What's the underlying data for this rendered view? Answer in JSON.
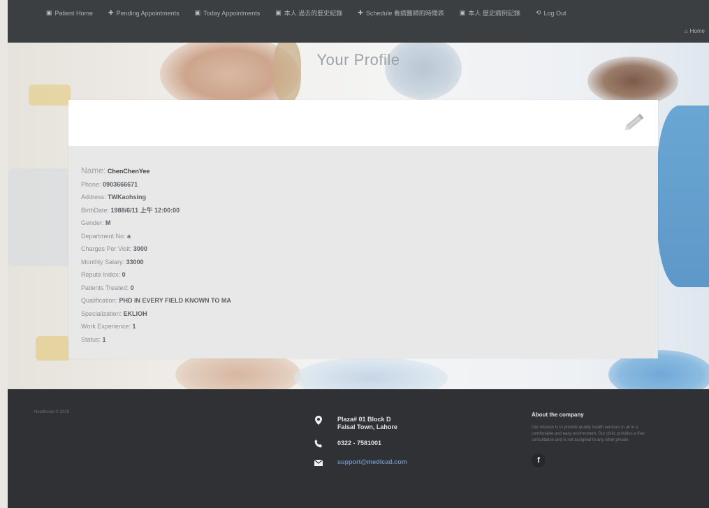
{
  "nav": {
    "items": [
      {
        "icon": "▣",
        "label": "Patient Home"
      },
      {
        "icon": "✚",
        "label": "Pending Appointments"
      },
      {
        "icon": "▣",
        "label": "Today Appointments"
      },
      {
        "icon": "▣",
        "label": "本人 過去的歷史紀錄"
      },
      {
        "icon": "✚",
        "label": "Schedule 看病醫師的時間表"
      },
      {
        "icon": "▣",
        "label": "本人 歷史病例記錄"
      },
      {
        "icon": "⟲",
        "label": "Log Out"
      }
    ],
    "home_label": "Home"
  },
  "page": {
    "title": "Your Profile"
  },
  "profile": {
    "name_label": "Name:",
    "name": "ChenChenYee",
    "fields": [
      {
        "label": "Phone:",
        "value": "0903666671"
      },
      {
        "label": "Address:",
        "value": "TWKaohsing"
      },
      {
        "label": "BirthDate:",
        "value": "1988/6/11 上午 12:00:00"
      },
      {
        "label": "Gender:",
        "value": "M"
      },
      {
        "label": "Department No:",
        "value": "a"
      },
      {
        "label": "Charges Per Visit:",
        "value": "3000"
      },
      {
        "label": "Monthly Salary:",
        "value": "33000"
      },
      {
        "label": "Repute Index:",
        "value": "0"
      },
      {
        "label": "Patients Treated:",
        "value": "0"
      },
      {
        "label": "Qualification:",
        "value": "PHD IN EVERY FIELD KNOWN TO MA"
      },
      {
        "label": "Specialization:",
        "value": "EKLIOH"
      },
      {
        "label": "Work Experience:",
        "value": "1"
      },
      {
        "label": "Status:",
        "value": "1"
      }
    ]
  },
  "footer": {
    "copyright": "Healthcare © 2019",
    "address_line1": "Plaza# 01 Block D",
    "address_line2": "Faisal Town, Lahore",
    "phone": "0322 - 7581001",
    "email": "support@medicad.com",
    "about_title": "About the company",
    "about_text": "Our mission is to provide quality health services in all in a comfortable and easy environment. Our clinic provides a free consultation and is not assigned to any other private.",
    "facebook_label": "f"
  }
}
